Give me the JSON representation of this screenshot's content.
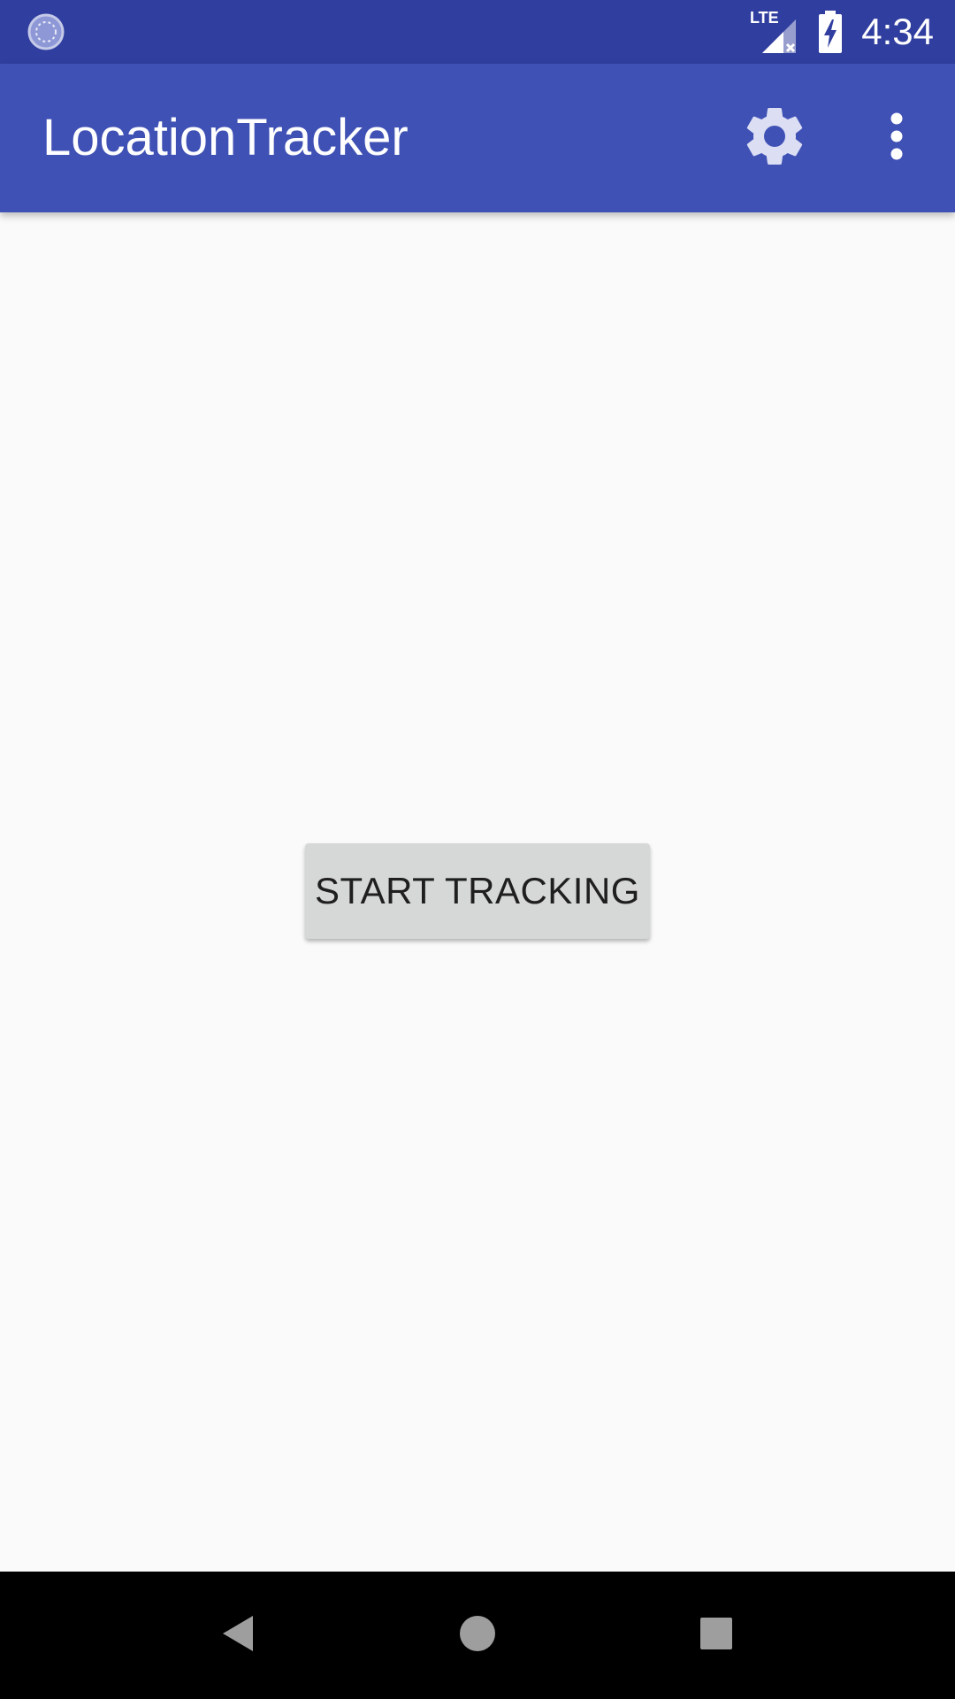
{
  "status_bar": {
    "time": "4:34",
    "network_label": "LTE",
    "icons": [
      "sync-notification-icon",
      "lte-signal-icon",
      "battery-charging-icon"
    ]
  },
  "app_bar": {
    "title": "LocationTracker",
    "actions": [
      "settings-icon",
      "overflow-menu-icon"
    ]
  },
  "main": {
    "start_button_label": "START TRACKING"
  },
  "nav_bar": {
    "buttons": [
      "back-icon",
      "home-icon",
      "recents-icon"
    ]
  },
  "colors": {
    "status_bar": "#303f9f",
    "app_bar": "#3f51b5",
    "background": "#fafafa",
    "button": "#d6d7d7"
  }
}
